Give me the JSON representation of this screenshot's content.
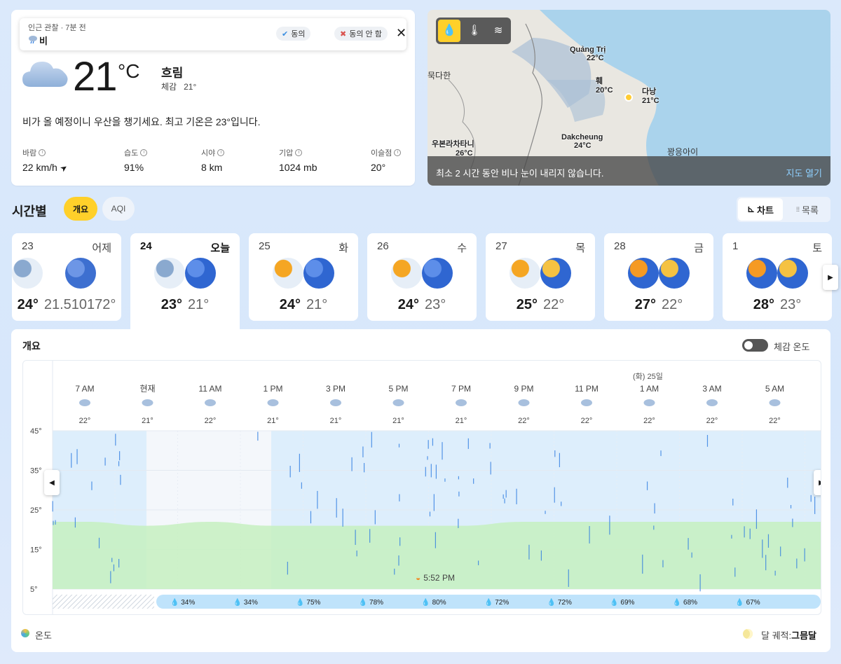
{
  "current": {
    "observation": {
      "label": "인근 관찰 · 7분 전",
      "value": "비",
      "agree": "동의",
      "disagree": "동의 안 함"
    },
    "temperature": "21",
    "unit": "°C",
    "condition": "흐림",
    "feels_like_label": "체감",
    "feels_like": "21°",
    "summary": "비가 올 예정이니 우산을 챙기세요. 최고 기온은 23°입니다.",
    "details": [
      {
        "label": "바람",
        "value": "22 km/h"
      },
      {
        "label": "습도",
        "value": "91%"
      },
      {
        "label": "시야",
        "value": "8 km"
      },
      {
        "label": "기압",
        "value": "1024 mb"
      },
      {
        "label": "이슬점",
        "value": "20°"
      }
    ]
  },
  "map": {
    "labels": [
      {
        "name": "Quảng Trị",
        "temp": "22°C"
      },
      {
        "name": "훼",
        "temp": "20°C"
      },
      {
        "name": "다낭",
        "temp": "21°C"
      },
      {
        "name": "Dakcheung",
        "temp": "24°C"
      },
      {
        "name": "우본라차타니",
        "temp": "26°C"
      }
    ],
    "plain_labels": [
      "묵다한",
      "꽝응아이"
    ],
    "message": "최소 2 시간 동안 비나 눈이 내리지 않습니다.",
    "open_link": "지도 열기"
  },
  "hourly": {
    "title": "시간별",
    "tabs": [
      "개요",
      "AQI"
    ],
    "views": [
      "차트",
      "목록"
    ]
  },
  "days": [
    {
      "date": "23",
      "weekday": "어제",
      "hi": "24°",
      "lo": "21.510172°",
      "icons": [
        "rain-cloud-icon",
        "rain-night-icon"
      ]
    },
    {
      "date": "24",
      "weekday": "오늘",
      "hi": "23°",
      "lo": "21°",
      "icons": [
        "rain-cloud-icon",
        "partly-cloudy-rain-icon"
      ]
    },
    {
      "date": "25",
      "weekday": "화",
      "hi": "24°",
      "lo": "21°",
      "icons": [
        "sun-rain-icon",
        "partly-cloudy-rain-icon"
      ]
    },
    {
      "date": "26",
      "weekday": "수",
      "hi": "24°",
      "lo": "23°",
      "icons": [
        "sun-rain-icon",
        "partly-cloudy-rain-icon"
      ]
    },
    {
      "date": "27",
      "weekday": "목",
      "hi": "25°",
      "lo": "22°",
      "icons": [
        "sun-rain-icon",
        "moon-cloud-icon"
      ]
    },
    {
      "date": "28",
      "weekday": "금",
      "hi": "27°",
      "lo": "22°",
      "icons": [
        "sun-cloud-icon",
        "moon-cloud-icon"
      ]
    },
    {
      "date": "1",
      "weekday": "토",
      "hi": "28°",
      "lo": "23°",
      "icons": [
        "sun-cloud-icon",
        "moon-cloud-icon"
      ]
    }
  ],
  "overview": {
    "title": "개요",
    "toggle_label": "체감 온도",
    "date_marker": "(화) 25일",
    "sunset": "5:52 PM",
    "legend": "온도",
    "moon_label": "달 궤적:",
    "moon_phase": "그믐달"
  },
  "chart_data": {
    "type": "area",
    "hours": [
      "7 AM",
      "현재",
      "11 AM",
      "1 PM",
      "3 PM",
      "5 PM",
      "7 PM",
      "9 PM",
      "11 PM",
      "1 AM",
      "3 AM",
      "5 AM"
    ],
    "temps": [
      "22°",
      "21°",
      "22°",
      "21°",
      "21°",
      "21°",
      "21°",
      "22°",
      "22°",
      "22°",
      "22°",
      "22°"
    ],
    "temp_values": [
      22,
      21,
      22,
      21,
      21,
      21,
      21,
      22,
      22,
      22,
      22,
      22
    ],
    "yticks": [
      "45°",
      "35°",
      "25°",
      "15°",
      "5°"
    ],
    "ylim": [
      5,
      45
    ],
    "precip": [
      "34%",
      "34%",
      "75%",
      "78%",
      "80%",
      "72%",
      "72%",
      "69%",
      "68%",
      "67%"
    ],
    "colors": {
      "temp_fill": "#c6f0c0",
      "rain_fill": "#ddeefc",
      "precip_bar": "#bfe3fb"
    }
  }
}
